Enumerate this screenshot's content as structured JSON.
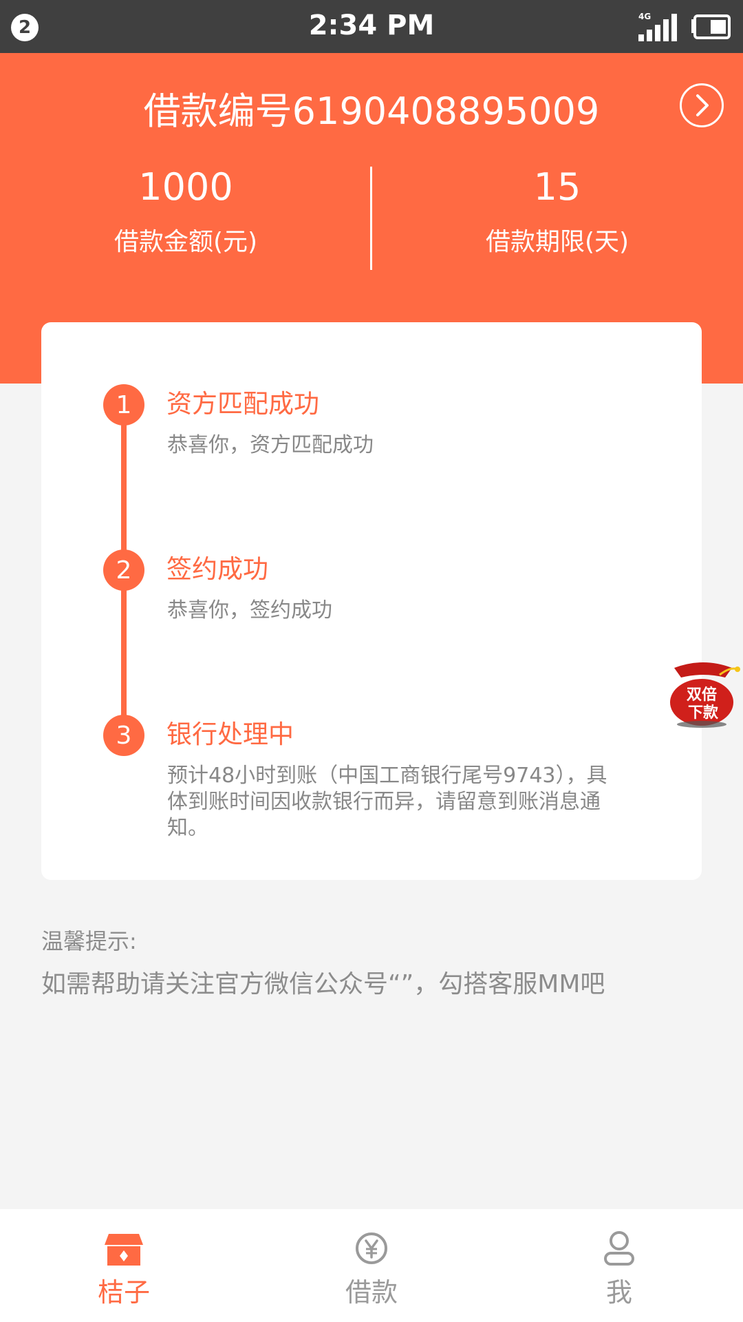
{
  "status_bar": {
    "notification_count": "2",
    "time": "2:34 PM",
    "network_label": "4G"
  },
  "header": {
    "loan_title": "借款编号6190408895009",
    "amount_value": "1000",
    "amount_label": "借款金额(元)",
    "term_value": "15",
    "term_label": "借款期限(天)"
  },
  "steps": [
    {
      "number": "1",
      "title": "资方匹配成功",
      "desc": "恭喜你，资方匹配成功"
    },
    {
      "number": "2",
      "title": "签约成功",
      "desc": "恭喜你，签约成功"
    },
    {
      "number": "3",
      "title": "银行处理中",
      "desc": "预计48小时到账（中国工商银行尾号9743），具体到账时间因收款银行而异，请留意到账消息通知。"
    }
  ],
  "tips": {
    "title": "温馨提示:",
    "text": "如需帮助请关注官方微信公众号“”，勾搭客服MM吧"
  },
  "promo": {
    "line1": "双倍",
    "line2": "下款"
  },
  "nav": {
    "items": [
      {
        "label": "桔子",
        "icon": "shop-icon"
      },
      {
        "label": "借款",
        "icon": "yuan-icon"
      },
      {
        "label": "我",
        "icon": "user-icon"
      }
    ]
  },
  "colors": {
    "primary": "#ff6a43",
    "status_bar": "#404040",
    "background": "#f4f4f4"
  }
}
